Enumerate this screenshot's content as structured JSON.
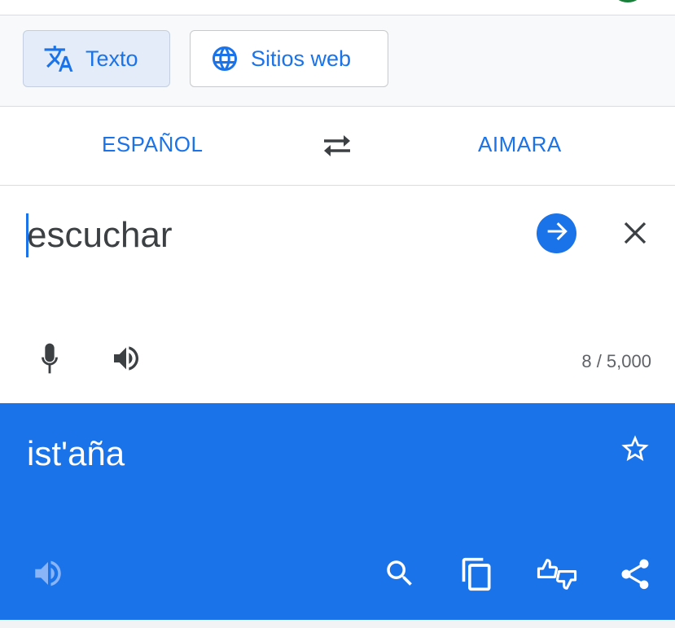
{
  "mode_tabs": [
    {
      "label": "Texto",
      "icon": "translate-icon",
      "selected": true
    },
    {
      "label": "Sitios web",
      "icon": "globe-icon",
      "selected": false
    }
  ],
  "languages": {
    "source": "ESPAÑOL",
    "target": "AIMARA"
  },
  "input": {
    "value": "escuchar",
    "char_count": "8 / 5,000"
  },
  "output": {
    "translation": "ist'aña"
  },
  "colors": {
    "accent": "#1a73e8",
    "chip_selected_bg": "#e3ecf8",
    "text_dark": "#3c4043",
    "text_muted": "#5f6368"
  }
}
